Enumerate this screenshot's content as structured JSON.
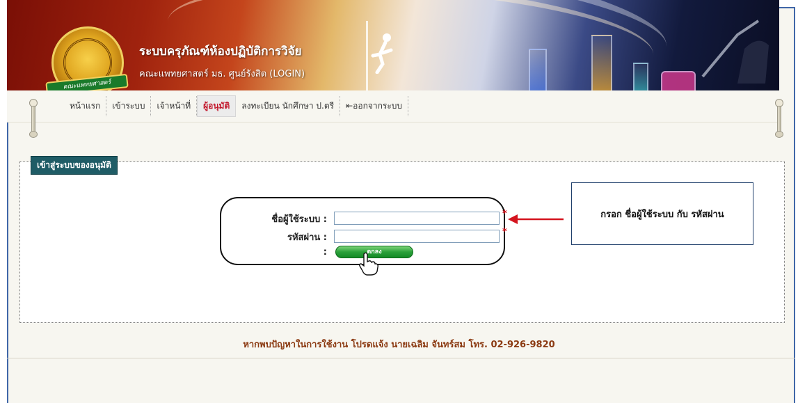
{
  "header": {
    "title": "ระบบครุภัณฑ์ห้องปฏิบัติการวิจัย",
    "subtitle": "คณะแพทยศาสตร์ มธ. ศูนย์รังสิต (LOGIN)",
    "seal_ribbon_text": "คณะแพทยศาสตร์"
  },
  "nav": {
    "items": [
      {
        "label": "หน้าแรก"
      },
      {
        "label": "เข้าระบบ"
      },
      {
        "label": "เจ้าหน้าที่"
      },
      {
        "label": "ผู้อนุมัติ",
        "active": true
      },
      {
        "label": "ลงทะเบียน นักศึกษา ป.ตรี"
      },
      {
        "label": "ออกจากระบบ"
      }
    ]
  },
  "panel": {
    "legend": "เข้าสู่ระบบของอนุมัติ"
  },
  "login": {
    "username_label": "ชื่อผู้ใช้ระบบ :",
    "username_value": "",
    "password_label": "รหัสผ่าน :",
    "password_value": "",
    "submit_colon": ":",
    "submit_label": "ตกลง",
    "required_mark": "*"
  },
  "callout": {
    "text": "กรอก ชื่อผู้ใช้ระบบ กับ รหัสผ่าน"
  },
  "footer": {
    "contact": "หากพบปัญหาในการใช้งาน โปรดแจ้ง นายเฉลิม จันทร์สม โทร. 02-926-9820"
  },
  "colors": {
    "frame_border": "#3f66a8",
    "active_nav": "#c2152a",
    "legend_bg": "#1f5c66",
    "submit_green": "#2aa03a",
    "footer_text": "#8b3a12",
    "required": "#d4141e"
  }
}
